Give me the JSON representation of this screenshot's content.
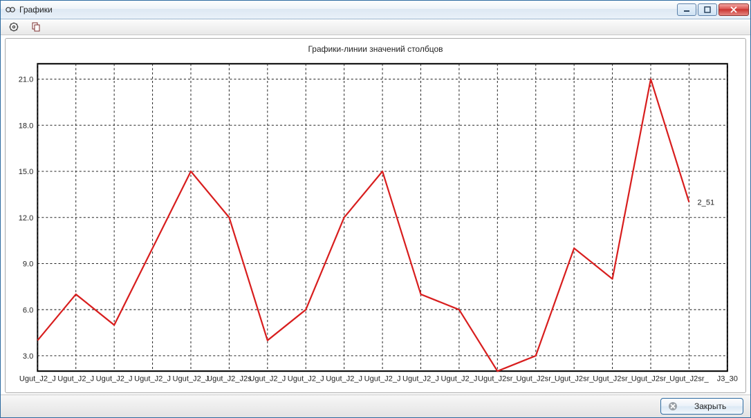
{
  "window": {
    "title": "Графики"
  },
  "toolbar": {
    "items": [
      "settings",
      "copy"
    ]
  },
  "footer": {
    "close_label": "Закрыть"
  },
  "chart_data": {
    "type": "line",
    "title": "Графики-линии значений столбцов",
    "categories": [
      "Ugut_J2_J",
      "Ugut_J2_J",
      "Ugut_J2_J",
      "Ugut_J2_J",
      "Ugut_J2_J",
      "Ugut_J2_J2s",
      "Ugut_J2_J",
      "Ugut_J2_J",
      "Ugut_J2_J",
      "Ugut_J2_J",
      "Ugut_J2_J",
      "Ugut_J2_J",
      "Ugut_J2sr_",
      "Ugut_J2sr_",
      "Ugut_J2sr_",
      "Ugut_J2sr_",
      "Ugut_J2sr_",
      "Ugut_J2sr_",
      "J3_30"
    ],
    "values": [
      4,
      7,
      5,
      10,
      15,
      12,
      4,
      6,
      12,
      15,
      7,
      6,
      2,
      3,
      10,
      8,
      21,
      13
    ],
    "series_length": 18,
    "ylim": [
      2,
      22
    ],
    "yticks": [
      3.0,
      6.0,
      9.0,
      12.0,
      15.0,
      18.0,
      21.0
    ],
    "xlabel": "",
    "ylabel": "",
    "line_color": "#d81e1e",
    "annotations": [
      {
        "label": "2_51",
        "x_index": 17,
        "y": 13,
        "dx": 12,
        "dy": 0
      }
    ]
  }
}
